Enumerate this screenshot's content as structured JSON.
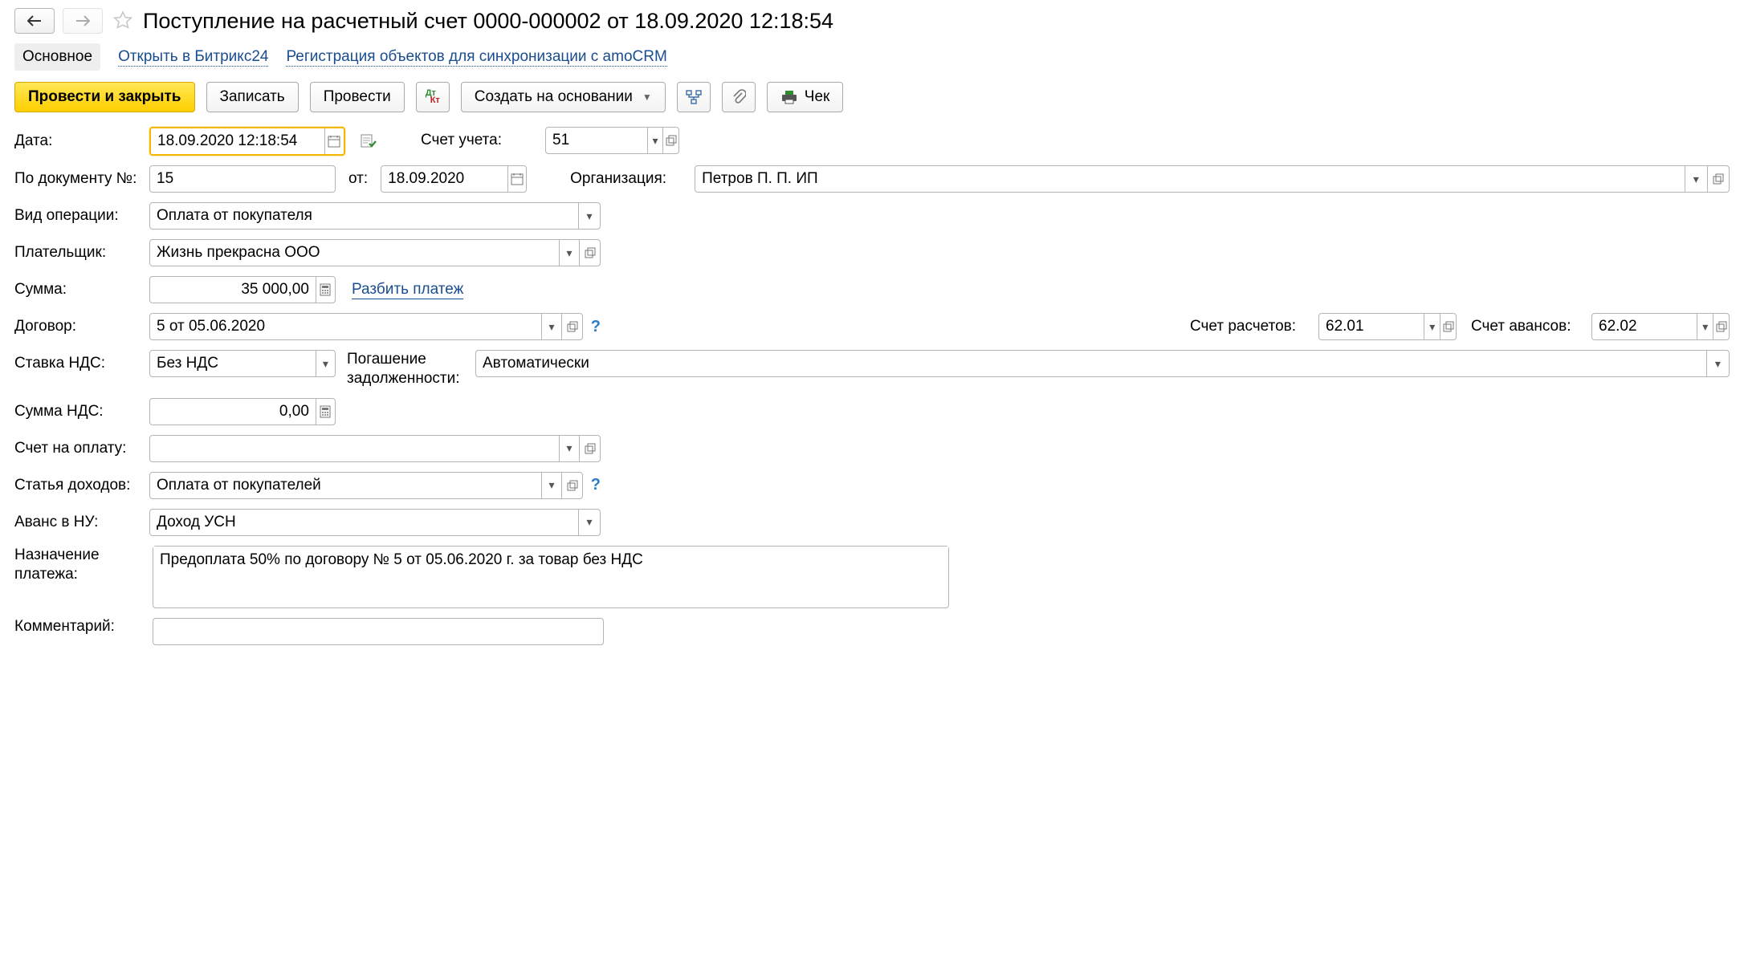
{
  "header": {
    "title": "Поступление на расчетный счет 0000-000002 от 18.09.2020 12:18:54"
  },
  "tabs": {
    "main": "Основное",
    "bitrix": "Открыть в Битрикс24",
    "amo": "Регистрация объектов для синхронизации с amoCRM"
  },
  "toolbar": {
    "post_close": "Провести и закрыть",
    "save": "Записать",
    "post": "Провести",
    "create_based": "Создать на основании",
    "check": "Чек"
  },
  "labels": {
    "date": "Дата:",
    "doc_no": "По документу №:",
    "from": "от:",
    "op_kind": "Вид операции:",
    "payer": "Плательщик:",
    "sum": "Сумма:",
    "split": "Разбить платеж",
    "contract": "Договор:",
    "vat_rate": "Ставка НДС:",
    "vat_sum": "Сумма НДС:",
    "invoice": "Счет на оплату:",
    "income_item": "Статья доходов:",
    "advance": "Аванс в НУ:",
    "purpose": "Назначение платежа:",
    "comment": "Комментарий:",
    "account": "Счет учета:",
    "org": "Организация:",
    "settle_acc": "Счет расчетов:",
    "advance_acc": "Счет авансов:",
    "debt_repay1": "Погашение",
    "debt_repay2": "задолженности:"
  },
  "values": {
    "date": "18.09.2020 12:18:54",
    "doc_no": "15",
    "doc_date": "18.09.2020",
    "op_kind": "Оплата от покупателя",
    "payer": "Жизнь прекрасна ООО",
    "sum": "35 000,00",
    "contract": "5 от 05.06.2020",
    "vat_rate": "Без НДС",
    "vat_sum": "0,00",
    "invoice": "",
    "income_item": "Оплата от покупателей",
    "advance": "Доход УСН",
    "purpose": "Предоплата 50% по договору № 5 от 05.06.2020 г. за товар без НДС",
    "comment": "",
    "account": "51",
    "org": "Петров П. П. ИП",
    "settle_acc": "62.01",
    "advance_acc": "62.02",
    "debt_repay": "Автоматически"
  }
}
